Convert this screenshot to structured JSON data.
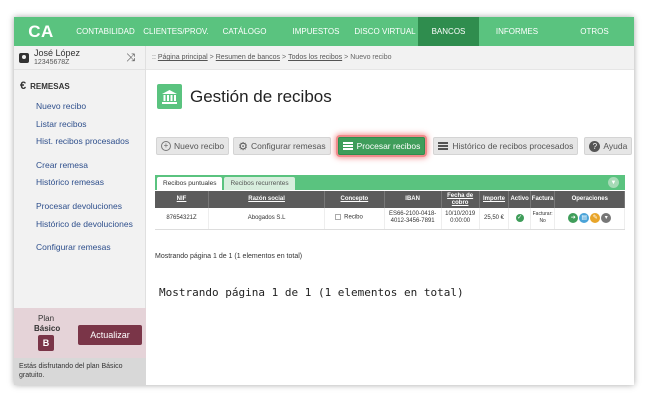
{
  "app": {
    "logo": "CA"
  },
  "nav": {
    "items": [
      "CONTABILIDAD",
      "CLIENTES/PROV.",
      "CATÁLOGO",
      "IMPUESTOS",
      "DISCO VIRTUAL",
      "BANCOS",
      "INFORMES",
      "OTROS"
    ],
    "active": "BANCOS"
  },
  "user": {
    "name": "José López",
    "id": "12345678Z"
  },
  "sidebar": {
    "section_title": "REMESAS",
    "items": [
      "Nuevo recibo",
      "Listar recibos",
      "Hist. recibos procesados",
      "Crear remesa",
      "Histórico remesas",
      "Procesar devoluciones",
      "Histórico de devoluciones",
      "Configurar remesas"
    ]
  },
  "plan": {
    "label": "Plan",
    "name": "Básico",
    "badge": "B",
    "upgrade_label": "Actualizar",
    "note": "Estás disfrutando del plan Básico gratuito."
  },
  "breadcrumb": {
    "prefix": "::",
    "items": [
      "Página principal",
      "Resumen de bancos",
      "Todos los recibos"
    ],
    "current": "Nuevo recibo",
    "separator": ">"
  },
  "page": {
    "title": "Gestión de recibos"
  },
  "toolbar": {
    "new_receipt": "Nuevo recibo",
    "configure": "Configurar remesas",
    "process": "Procesar recibos",
    "history": "Histórico de recibos procesados",
    "help": "Ayuda"
  },
  "tabs": {
    "items": [
      "Recibos puntuales",
      "Recibos recurrentes"
    ],
    "active": "Recibos puntuales"
  },
  "table": {
    "headers": [
      "NIF",
      "Razón social",
      "Concepto",
      "IBAN",
      "Fecha de cobro",
      "Importe",
      "Activo",
      "Factura",
      "Operaciones"
    ],
    "rows": [
      {
        "nif": "87654321Z",
        "razon": "Abogados S.L",
        "concepto": "Recibo",
        "iban": "ES66-2100-0418-4012-3456-7891",
        "fecha": "10/10/2019 0:00:00",
        "importe": "25,50 €",
        "factura": "Facturar: No"
      }
    ]
  },
  "pagination": {
    "small": "Mostrando página 1 de 1 (1 elementos en total)",
    "large": "Mostrando página 1 de 1 (1 elementos en total)"
  },
  "colors": {
    "brand_green": "#5ac37f",
    "active_green": "#2f8d4e",
    "plan_accent": "#7a3548",
    "highlight_red": "#eb3c3c"
  },
  "icons": [
    "user-icon",
    "shuffle-icon",
    "euro-icon",
    "bank-icon",
    "plus-circle-icon",
    "gear-icon",
    "list-icon",
    "help-icon",
    "chevron-down-icon",
    "check-icon",
    "arrow-right-icon",
    "document-icon",
    "edit-icon",
    "more-icon"
  ]
}
